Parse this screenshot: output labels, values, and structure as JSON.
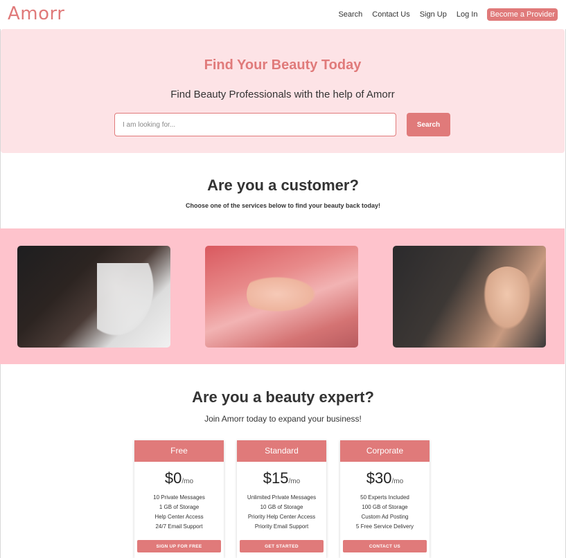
{
  "nav": {
    "brand": "Amorr",
    "links": [
      "Search",
      "Contact Us",
      "Sign Up",
      "Log In"
    ],
    "cta": "Become a Provider"
  },
  "hero": {
    "title": "Find Your Beauty Today",
    "subtitle": "Find Beauty Professionals with the help of Amorr",
    "search_placeholder": "I am looking for...",
    "search_button": "Search"
  },
  "customer": {
    "title": "Are you a customer?",
    "subtitle": "Choose one of the services below to find your beauty back today!"
  },
  "expert": {
    "title": "Are you a beauty expert?",
    "subtitle": "Join Amorr today to expand your business!"
  },
  "plans": [
    {
      "name": "Free",
      "price": "$0",
      "period": "/mo",
      "features": [
        "10 Private Messages",
        "1 GB of Storage",
        "Help Center Access",
        "24/7 Email Support"
      ],
      "button": "SIGN UP FOR FREE"
    },
    {
      "name": "Standard",
      "price": "$15",
      "period": "/mo",
      "features": [
        "Unlimited Private Messages",
        "10 GB of Storage",
        "Priority Help Center Access",
        "Priority Email Support"
      ],
      "button": "GET STARTED"
    },
    {
      "name": "Corporate",
      "price": "$30",
      "period": "/mo",
      "features": [
        "50 Experts Included",
        "100 GB of Storage",
        "Custom Ad Posting",
        "5 Free Service Delivery"
      ],
      "button": "CONTACT US"
    }
  ],
  "colors": {
    "accent": "#e07a7a",
    "hero_bg": "#fde3e6",
    "band_bg": "#fec3cc"
  }
}
